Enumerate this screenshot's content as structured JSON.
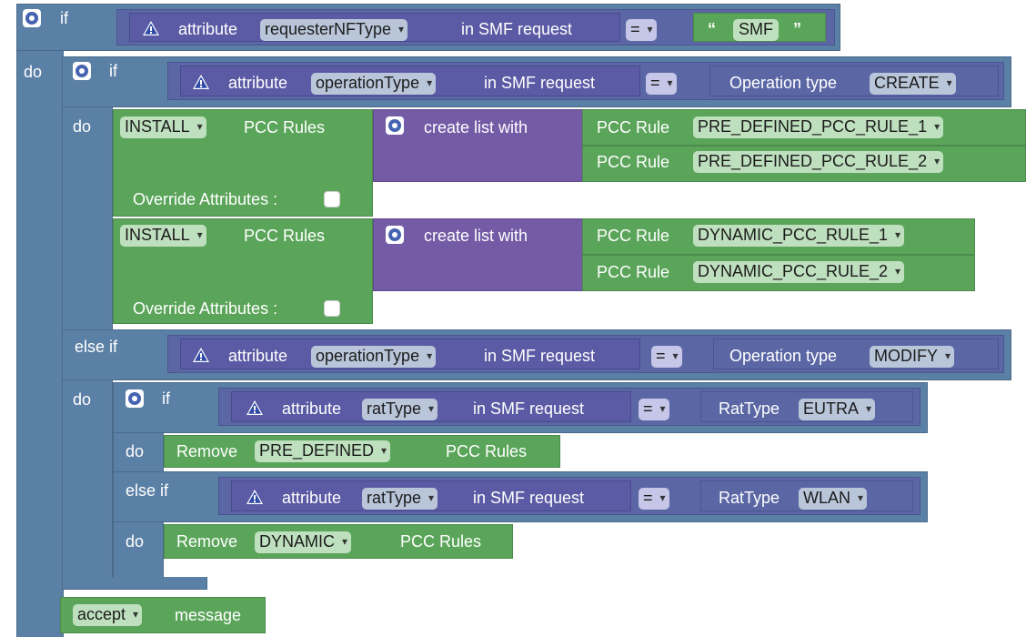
{
  "blocks": {
    "if_kw": "if",
    "do_kw": "do",
    "elseif_kw": "else if",
    "attr_word": "attribute",
    "in_smf": "in SMF request",
    "eq": "=",
    "smf_open_quote": "“",
    "smf_close_quote": "”",
    "smf_value": "SMF",
    "outer_attr": "requesterNFType",
    "op_attr": "operationType",
    "op_type_label": "Operation type",
    "op_create": "CREATE",
    "op_modify": "MODIFY",
    "install": "INSTALL",
    "pcc_rules": "PCC Rules",
    "create_list": "create list with",
    "pcc_rule": "PCC Rule",
    "rule_pre1": "PRE_DEFINED_PCC_RULE_1",
    "rule_pre2": "PRE_DEFINED_PCC_RULE_2",
    "rule_dyn1": "DYNAMIC_PCC_RULE_1",
    "rule_dyn2": "DYNAMIC_PCC_RULE_2",
    "override": "Override Attributes :",
    "rat_attr": "ratType",
    "rattype_label": "RatType",
    "rat_eutra": "EUTRA",
    "rat_wlan": "WLAN",
    "remove": "Remove",
    "remove_pre": "PRE_DEFINED",
    "remove_dyn": "DYNAMIC",
    "accept": "accept",
    "message": "message"
  },
  "colors": {
    "control": "#5b80a5",
    "compare": "#5b67a5",
    "attribute": "#5b5ba5",
    "list": "#745ba5",
    "action": "#5ba55b"
  }
}
